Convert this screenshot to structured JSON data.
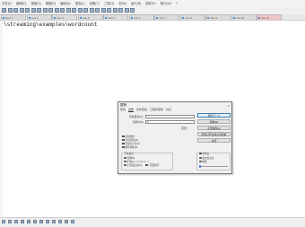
{
  "menu": {
    "items": [
      "文件(F)",
      "编辑(E)",
      "搜索(S)",
      "视图(V)",
      "编码(N)",
      "语言(L)",
      "设置(T)",
      "工具(O)",
      "宏(M)",
      "运行(R)",
      "插件(P)",
      "窗口(W)",
      "?"
    ]
  },
  "tabs": [
    {
      "label": "new 1"
    },
    {
      "label": "new 2"
    },
    {
      "label": "new 3"
    },
    {
      "label": "new 4"
    },
    {
      "label": "new 5"
    },
    {
      "label": "new 6"
    },
    {
      "label": "new 7"
    },
    {
      "label": "new 8"
    },
    {
      "label": "new 9"
    },
    {
      "label": "new 10"
    },
    {
      "label": "new 11"
    }
  ],
  "editor": {
    "line1": "\\streaming\\examples\\wordcount"
  },
  "statusline": {
    "length": "length : 41",
    "lines": "lines : 1",
    "ln": "Ln : 1",
    "col": "Col : 42",
    "sel": "Sel : 0 | 0",
    "eol": "Windows (CR LF)"
  },
  "dialog": {
    "title": "替换",
    "tabs": [
      "查找",
      "替换",
      "文件查找",
      "工程中查找",
      "标记"
    ],
    "find_label": "查找目标(N)：",
    "find_value": "",
    "replace_label": "替换为(P)：",
    "replace_value": "\\\\",
    "scope_label": "范围：",
    "buttons": [
      "查找下一个",
      "替换(R)",
      "全部替换(A)",
      "所有打开文件全部替换",
      "关闭"
    ],
    "options": [
      "反向查找",
      "全词匹配(W)",
      "匹配大小写(C)",
      "循环查找(D)"
    ],
    "mode_label": "查找模式",
    "modes": [
      "普通(N)",
      "扩展(\\n, \\r, \\t, \\0, \\x...)",
      "正则表达式(G)",
      ". 匹配新行"
    ],
    "transparency_label": "透明度",
    "transparency_options": [
      "失去焦点后",
      "始终"
    ]
  }
}
